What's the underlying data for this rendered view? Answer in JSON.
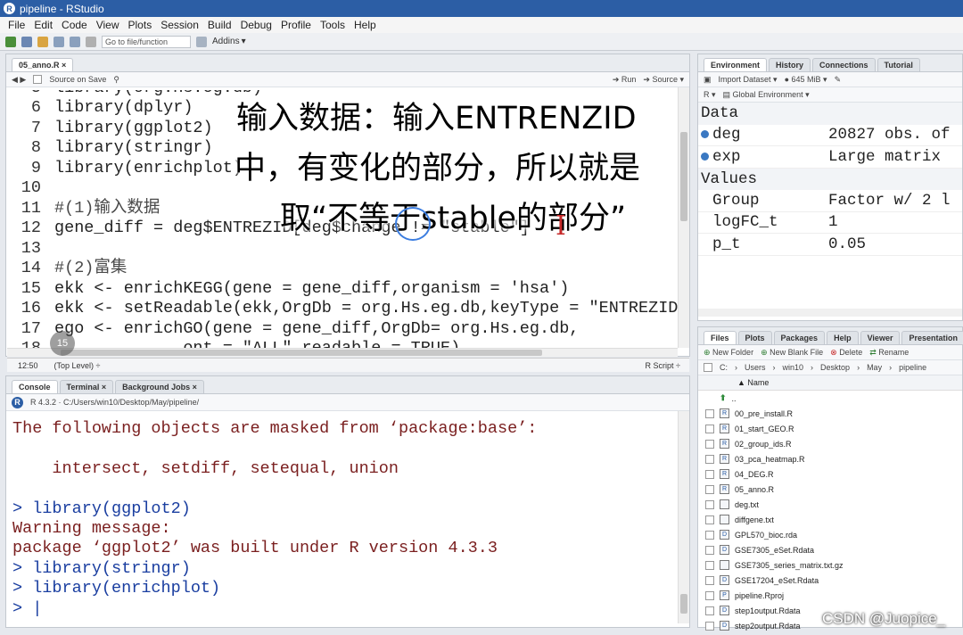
{
  "window": {
    "title": "pipeline - RStudio",
    "logo": "R"
  },
  "menu": [
    "File",
    "Edit",
    "Code",
    "View",
    "Plots",
    "Session",
    "Build",
    "Debug",
    "Profile",
    "Tools",
    "Help"
  ],
  "toolbar": {
    "goto_placeholder": "Go to file/function",
    "addins": "Addins"
  },
  "editor": {
    "tab": "05_anno.R",
    "source_on_save": "Source on Save",
    "run": "Run",
    "source": "Source",
    "lines": [
      {
        "n": "5",
        "text": "library(org.Hs.eg.db)"
      },
      {
        "n": "6",
        "text": "library(dplyr)"
      },
      {
        "n": "7",
        "text": "library(ggplot2)"
      },
      {
        "n": "8",
        "text": "library(stringr)"
      },
      {
        "n": "9",
        "text": "library(enrichplot)"
      },
      {
        "n": "10",
        "text": ""
      },
      {
        "n": "11",
        "text": "#(1)输入数据"
      },
      {
        "n": "12",
        "text": "gene_diff = deg$ENTREZID[deg$change != \"stable\"]"
      },
      {
        "n": "13",
        "text": ""
      },
      {
        "n": "14",
        "text": "#(2)富集"
      },
      {
        "n": "15",
        "text": "ekk <- enrichKEGG(gene = gene_diff,organism = 'hsa')"
      },
      {
        "n": "16",
        "text": "ekk <- setReadable(ekk,OrgDb = org.Hs.eg.db,keyType = \"ENTREZID\")"
      },
      {
        "n": "17",
        "text": "ego <- enrichGO(gene = gene_diff,OrgDb= org.Hs.eg.db,"
      },
      {
        "n": "18",
        "text": "             ont = \"ALL\",readable = TRUE)"
      }
    ],
    "status_pos": "12:50",
    "status_level": "(Top Level) ÷",
    "status_type": "R Script ÷"
  },
  "overlay": {
    "line1": "输入数据：输入ENTRENZID",
    "line2": "中，有变化的部分，所以就是",
    "line3": "取“不等于stable的部分”"
  },
  "console": {
    "tabs": [
      "Console",
      "Terminal",
      "Background Jobs"
    ],
    "path": "R 4.3.2 · C:/Users/win10/Desktop/May/pipeline/",
    "lines": [
      {
        "cls": "crimson",
        "text": "The following objects are masked from ‘package:base’:"
      },
      {
        "cls": "",
        "text": ""
      },
      {
        "cls": "crimson",
        "text": "    intersect, setdiff, setequal, union"
      },
      {
        "cls": "",
        "text": ""
      },
      {
        "cls": "prompt",
        "text": "> library(ggplot2)"
      },
      {
        "cls": "crimson",
        "text": "Warning message:"
      },
      {
        "cls": "crimson",
        "text": "package ‘ggplot2’ was built under R version 4.3.3"
      },
      {
        "cls": "prompt",
        "text": "> library(stringr)"
      },
      {
        "cls": "prompt",
        "text": "> library(enrichplot)"
      },
      {
        "cls": "prompt",
        "text": "> |"
      }
    ]
  },
  "environment": {
    "tabs": [
      "Environment",
      "History",
      "Connections",
      "Tutorial"
    ],
    "import": "Import Dataset",
    "memory": "645 MiB",
    "scope": "Global Environment",
    "lang": "R",
    "data_header": "Data",
    "data": [
      {
        "name": "deg",
        "value": "20827 obs. of"
      },
      {
        "name": "exp",
        "value": "Large matrix"
      }
    ],
    "values_header": "Values",
    "values": [
      {
        "name": "Group",
        "value": "Factor w/ 2 l"
      },
      {
        "name": "logFC_t",
        "value": "1"
      },
      {
        "name": "p_t",
        "value": "0.05"
      }
    ]
  },
  "files": {
    "tabs": [
      "Files",
      "Plots",
      "Packages",
      "Help",
      "Viewer",
      "Presentation"
    ],
    "actions": [
      "New Folder",
      "New Blank File",
      "Delete",
      "Rename"
    ],
    "breadcrumb": [
      "C:",
      "Users",
      "win10",
      "Desktop",
      "May",
      "pipeline"
    ],
    "name_col": "Name",
    "up": "..",
    "items": [
      "00_pre_install.R",
      "01_start_GEO.R",
      "02_group_ids.R",
      "03_pca_heatmap.R",
      "04_DEG.R",
      "05_anno.R",
      "deg.txt",
      "diffgene.txt",
      "GPL570_bioc.rda",
      "GSE7305_eSet.Rdata",
      "GSE7305_series_matrix.txt.gz",
      "GSE17204_eSet.Rdata",
      "pipeline.Rproj",
      "step1output.Rdata",
      "step2output.Rdata"
    ]
  },
  "watermark": "CSDN @Juopice_",
  "badge": "15"
}
